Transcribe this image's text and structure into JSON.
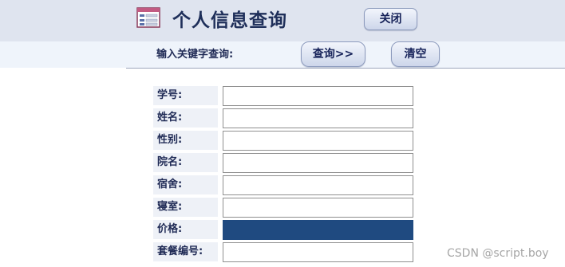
{
  "header": {
    "title": "个人信息查询",
    "close_label": "关闭",
    "icon": "form-icon"
  },
  "search": {
    "label": "输入关键字查询:",
    "query_label": "查询>>",
    "clear_label": "清空"
  },
  "fields": [
    {
      "label": "学号:",
      "value": ""
    },
    {
      "label": "姓名:",
      "value": ""
    },
    {
      "label": "性别:",
      "value": ""
    },
    {
      "label": "院名:",
      "value": ""
    },
    {
      "label": "宿舍:",
      "value": ""
    },
    {
      "label": "寝室:",
      "value": ""
    },
    {
      "label": "价格:",
      "value": ""
    },
    {
      "label": "套餐编号:",
      "value": ""
    }
  ],
  "watermark": "CSDN @script.boy",
  "colors": {
    "header_bg": "#dfe4ef",
    "searchbar_bg": "#eff4fb",
    "label_text": "#1f2a55",
    "active_field": "#1f4a80"
  }
}
